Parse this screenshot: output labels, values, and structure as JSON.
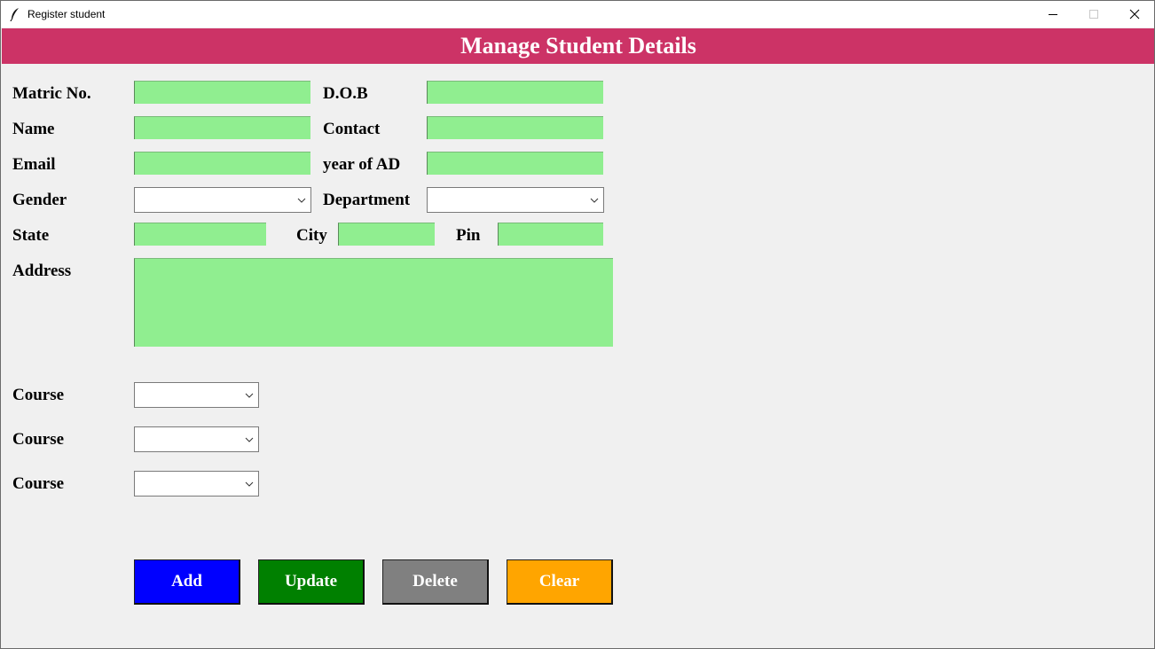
{
  "window": {
    "title": "Register student"
  },
  "header": {
    "title": "Manage Student Details",
    "color": "#cc3366"
  },
  "form": {
    "matric_label": "Matric No.",
    "dob_label": "D.O.B",
    "name_label": "Name",
    "contact_label": "Contact",
    "email_label": "Email",
    "year_label": "year of AD",
    "gender_label": "Gender",
    "department_label": "Department",
    "state_label": "State",
    "city_label": "City",
    "pin_label": "Pin",
    "address_label": "Address",
    "course1_label": "Course",
    "course2_label": "Course",
    "course3_label": "Course",
    "values": {
      "matric": "",
      "dob": "",
      "name": "",
      "contact": "",
      "email": "",
      "year": "",
      "gender": "",
      "department": "",
      "state": "",
      "city": "",
      "pin": "",
      "address": "",
      "course1": "",
      "course2": "",
      "course3": ""
    },
    "entry_color": "#90ee90"
  },
  "buttons": {
    "add": {
      "label": "Add",
      "color": "#0000ff"
    },
    "update": {
      "label": "Update",
      "color": "#008000"
    },
    "delete": {
      "label": "Delete",
      "color": "#808080"
    },
    "clear": {
      "label": "Clear",
      "color": "#ffa500"
    }
  },
  "icons": {
    "app": "feather-icon",
    "minimize": "minimize-icon",
    "maximize": "maximize-icon",
    "close": "close-icon",
    "dropdown": "chevron-down-icon"
  }
}
